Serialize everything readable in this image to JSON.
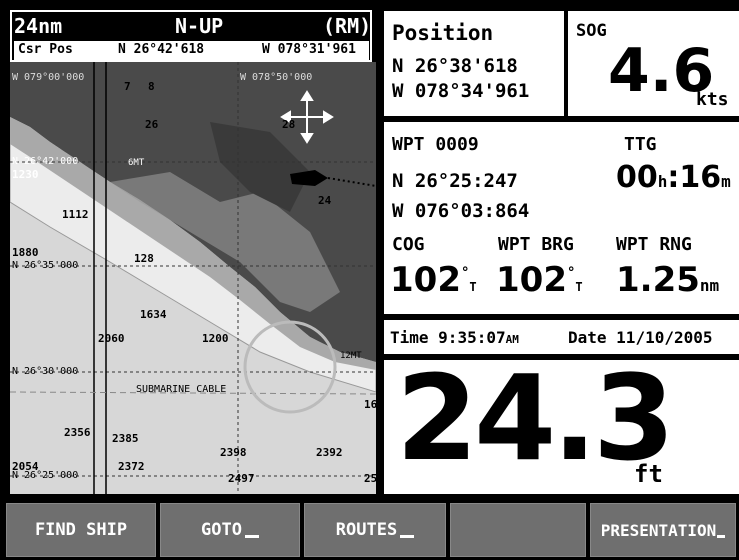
{
  "chart": {
    "range": "24nm",
    "orientation": "N-UP",
    "motion_mode": "(RM)",
    "cursor": {
      "label": "Csr Pos",
      "lat": "N  26°42'618",
      "lon": "W 078°31'961"
    },
    "grid_labels": {
      "lon_left": "W 079°00'000",
      "lon_right": "W 078°50'000",
      "lat_1": "N 26°42'000",
      "lat_2": "N 26°35'000",
      "lat_3": "N 26°30'000",
      "lat_4": "N 26°25'000"
    },
    "depths": [
      "7",
      "8",
      "26",
      "28",
      "24",
      "1230",
      "1112",
      "1880",
      "128",
      "1634",
      "2060",
      "1200",
      "2356",
      "2385",
      "2398",
      "2392",
      "2054",
      "2372",
      "2497",
      "25",
      "16"
    ],
    "labels": {
      "submarine_cable": "SUBMARINE CABLE",
      "light_1": "6MT",
      "light_2": "12MT"
    }
  },
  "position": {
    "title": "Position",
    "lat": "N  26°38'618",
    "lon": "W 078°34'961"
  },
  "sog": {
    "title": "SOG",
    "value": "4.6",
    "unit": "kts"
  },
  "waypoint": {
    "name": "WPT 0009",
    "lat": "N  26°25:247",
    "lon": "W 076°03:864",
    "ttg_label": "TTG",
    "ttg_h": "00",
    "ttg_h_unit": "h",
    "ttg_m": "16",
    "ttg_m_unit": "m",
    "cog_label": "COG",
    "cog_value": "102",
    "cog_ref": "T",
    "brg_label": "WPT BRG",
    "brg_value": "102",
    "brg_ref": "T",
    "rng_label": "WPT RNG",
    "rng_value": "1.25",
    "rng_unit": "nm"
  },
  "time": {
    "label": "Time",
    "value": "9:35:07",
    "ampm": "AM",
    "date_label": "Date",
    "date": "11/10/2005"
  },
  "depth": {
    "value": "24.3",
    "unit": "ft"
  },
  "softkeys": [
    "FIND SHIP",
    "GOTO",
    "ROUTES",
    "",
    "PRESENTATION"
  ]
}
